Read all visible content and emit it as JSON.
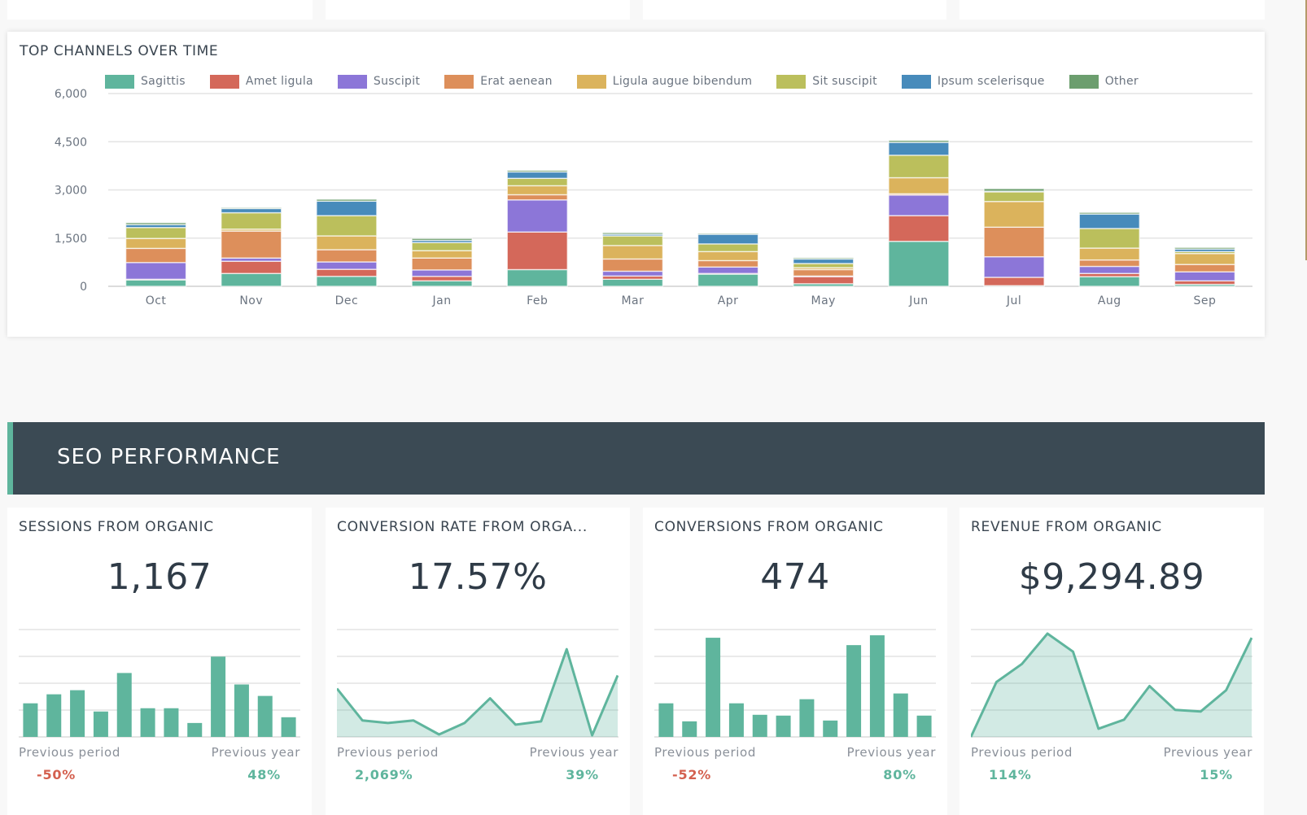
{
  "colors": {
    "positive": "#5fb59d",
    "negative": "#d4604f",
    "header_bg": "#3b4a54",
    "accent": "#5fb59d"
  },
  "channels_card": {
    "title": "TOP CHANNELS OVER TIME"
  },
  "chart_data": {
    "type": "bar",
    "stacked": true,
    "title": "TOP CHANNELS OVER TIME",
    "xlabel": "",
    "ylabel": "",
    "ylim": [
      0,
      6000
    ],
    "yticks": [
      0,
      1500,
      3000,
      4500,
      6000
    ],
    "ytick_labels": [
      "0",
      "1,500",
      "3,000",
      "4,500",
      "6,000"
    ],
    "grid": true,
    "legend_position": "top",
    "categories": [
      "Oct",
      "Nov",
      "Dec",
      "Jan",
      "Feb",
      "Mar",
      "Apr",
      "May",
      "Jun",
      "Jul",
      "Aug",
      "Sep"
    ],
    "series": [
      {
        "name": "Sagittis",
        "color": "#5fb59d",
        "values": [
          200,
          400,
          310,
          170,
          520,
          220,
          380,
          80,
          1400,
          20,
          300,
          60
        ]
      },
      {
        "name": "Amet ligula",
        "color": "#d4685a",
        "values": [
          20,
          380,
          220,
          140,
          1170,
          100,
          20,
          220,
          800,
          260,
          100,
          110
        ]
      },
      {
        "name": "Suscipit",
        "color": "#8c76d8",
        "values": [
          520,
          100,
          230,
          200,
          1000,
          150,
          200,
          20,
          640,
          640,
          220,
          280
        ]
      },
      {
        "name": "Erat aenean",
        "color": "#dd8f5b",
        "values": [
          440,
          840,
          380,
          370,
          160,
          380,
          200,
          200,
          40,
          920,
          200,
          230
        ]
      },
      {
        "name": "Ligula augue bibendum",
        "color": "#dbb35c",
        "values": [
          310,
          60,
          430,
          230,
          280,
          420,
          280,
          60,
          500,
          800,
          370,
          340
        ]
      },
      {
        "name": "Sit suscipit",
        "color": "#bbbf5c",
        "values": [
          340,
          510,
          630,
          250,
          230,
          300,
          240,
          130,
          700,
          300,
          610,
          60
        ]
      },
      {
        "name": "Ipsum scelerisque",
        "color": "#478bbb",
        "values": [
          90,
          130,
          450,
          70,
          200,
          50,
          300,
          140,
          400,
          20,
          450,
          80
        ]
      },
      {
        "name": "Other",
        "color": "#6c9e6e",
        "values": [
          60,
          30,
          60,
          60,
          50,
          50,
          30,
          40,
          60,
          80,
          50,
          50
        ]
      }
    ]
  },
  "section": {
    "title": "SEO PERFORMANCE"
  },
  "kpis": [
    {
      "title": "SESSIONS FROM ORGANIC",
      "value": "1,167",
      "spark_type": "bar",
      "spark_values": [
        41,
        52,
        57,
        31,
        78,
        35,
        35,
        17,
        98,
        64,
        50,
        24
      ],
      "spark_max": 131,
      "prev_period_label": "Previous period",
      "prev_period_value": "-50%",
      "prev_period_trend": "negative",
      "prev_year_label": "Previous year",
      "prev_year_value": "48%",
      "prev_year_trend": "positive"
    },
    {
      "title": "CONVERSION RATE FROM ORGA...",
      "value": "17.57%",
      "spark_type": "area",
      "spark_values": [
        59,
        20,
        17,
        20,
        3,
        17,
        47,
        15,
        19,
        107,
        2,
        75
      ],
      "spark_max": 131,
      "prev_period_label": "Previous period",
      "prev_period_value": "2,069%",
      "prev_period_trend": "positive",
      "prev_year_label": "Previous year",
      "prev_year_value": "39%",
      "prev_year_trend": "positive"
    },
    {
      "title": "CONVERSIONS FROM ORGANIC",
      "value": "474",
      "spark_type": "bar",
      "spark_values": [
        41,
        19,
        121,
        41,
        27,
        26,
        46,
        20,
        112,
        124,
        53,
        26
      ],
      "spark_max": 131,
      "prev_period_label": "Previous period",
      "prev_period_value": "-52%",
      "prev_period_trend": "negative",
      "prev_year_label": "Previous year",
      "prev_year_value": "80%",
      "prev_year_trend": "positive"
    },
    {
      "title": "REVENUE FROM ORGANIC",
      "value": "$9,294.89",
      "spark_type": "area",
      "spark_values": [
        0,
        67,
        89,
        126,
        104,
        10,
        21,
        62,
        33,
        31,
        57,
        121
      ],
      "spark_max": 131,
      "prev_period_label": "Previous period",
      "prev_period_value": "114%",
      "prev_period_trend": "positive",
      "prev_year_label": "Previous year",
      "prev_year_value": "15%",
      "prev_year_trend": "positive"
    }
  ]
}
